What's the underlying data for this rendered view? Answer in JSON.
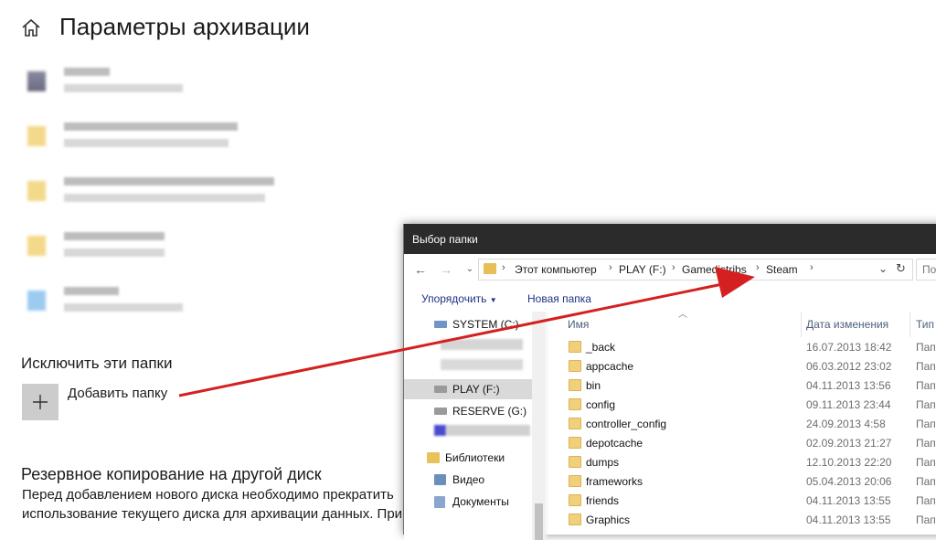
{
  "page": {
    "title": "Параметры архивации"
  },
  "exclude": {
    "heading": "Исключить эти папки",
    "add_label": "Добавить папку"
  },
  "other_disk": {
    "heading": "Резервное копирование на другой диск",
    "description": "Перед добавлением нового диска необходимо прекратить использование текущего диска для архивации данных. При"
  },
  "dialog": {
    "title": "Выбор папки",
    "breadcrumb": [
      "Этот компьютер",
      "PLAY (F:)",
      "Gamedistribs",
      "Steam"
    ],
    "search_placeholder": "По",
    "toolbar": {
      "organize": "Упорядочить",
      "new_folder": "Новая папка"
    },
    "nav": [
      {
        "label": "SYSTEM (C:)"
      },
      {
        "label": "PLAY (F:)"
      },
      {
        "label": "RESERVE (G:)"
      },
      {
        "label": "Библиотеки"
      },
      {
        "label": "Видео"
      },
      {
        "label": "Документы"
      }
    ],
    "columns": {
      "name": "Имя",
      "date": "Дата изменения",
      "type": "Тип"
    },
    "files": [
      {
        "name": "_back",
        "date": "16.07.2013 18:42",
        "type": "Папк"
      },
      {
        "name": "appcache",
        "date": "06.03.2012 23:02",
        "type": "Папк"
      },
      {
        "name": "bin",
        "date": "04.11.2013 13:56",
        "type": "Папк"
      },
      {
        "name": "config",
        "date": "09.11.2013 23:44",
        "type": "Папк"
      },
      {
        "name": "controller_config",
        "date": "24.09.2013 4:58",
        "type": "Папк"
      },
      {
        "name": "depotcache",
        "date": "02.09.2013 21:27",
        "type": "Папк"
      },
      {
        "name": "dumps",
        "date": "12.10.2013 22:20",
        "type": "Папк"
      },
      {
        "name": "frameworks",
        "date": "05.04.2013 20:06",
        "type": "Папк"
      },
      {
        "name": "friends",
        "date": "04.11.2013 13:55",
        "type": "Папк"
      },
      {
        "name": "Graphics",
        "date": "04.11.2013 13:55",
        "type": "Папк"
      }
    ]
  },
  "colors": {
    "accent_link": "#1e3287",
    "annotation_arrow": "#d42020",
    "dialog_titlebar": "#2b2b2b",
    "folder_yellow": "#f0d07b"
  }
}
